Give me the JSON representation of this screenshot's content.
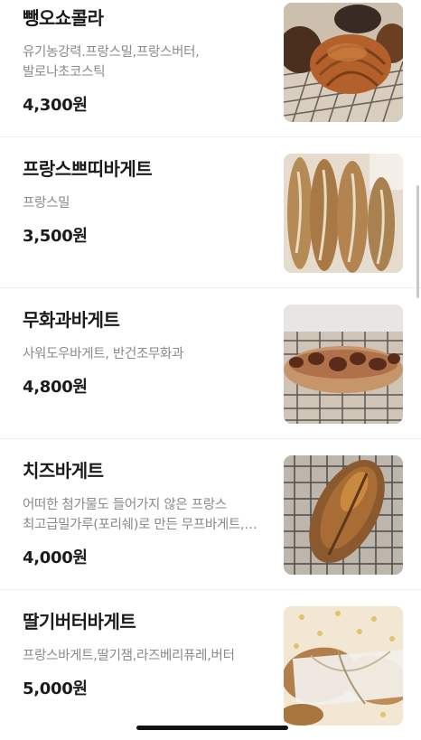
{
  "menu": [
    {
      "name": "뺑오쇼콜라",
      "desc": "유기농강력.프랑스밀,프랑스버터,발로나초코스틱",
      "price": "4,300원",
      "image": "pain-au-chocolat-photo"
    },
    {
      "name": "프랑스쁘띠바게트",
      "desc": "프랑스밀",
      "price": "3,500원",
      "image": "petit-baguette-photo"
    },
    {
      "name": "무화과바게트",
      "desc": "사워도우바게트, 반건조무화과",
      "price": "4,800원",
      "image": "fig-baguette-photo"
    },
    {
      "name": "치즈바게트",
      "desc": "어떠한 첨가물도 들어가지 않은 프랑스 최고급밀가루(포리쉐)로 만든 무프바게트,치즈...",
      "price": "4,000원",
      "image": "cheese-baguette-photo"
    },
    {
      "name": "딸기버터바게트",
      "desc": "프랑스바게트,딸기잼,라즈베리퓨레,버터",
      "price": "5,000원",
      "image": "strawberry-butter-baguette-photo"
    }
  ]
}
